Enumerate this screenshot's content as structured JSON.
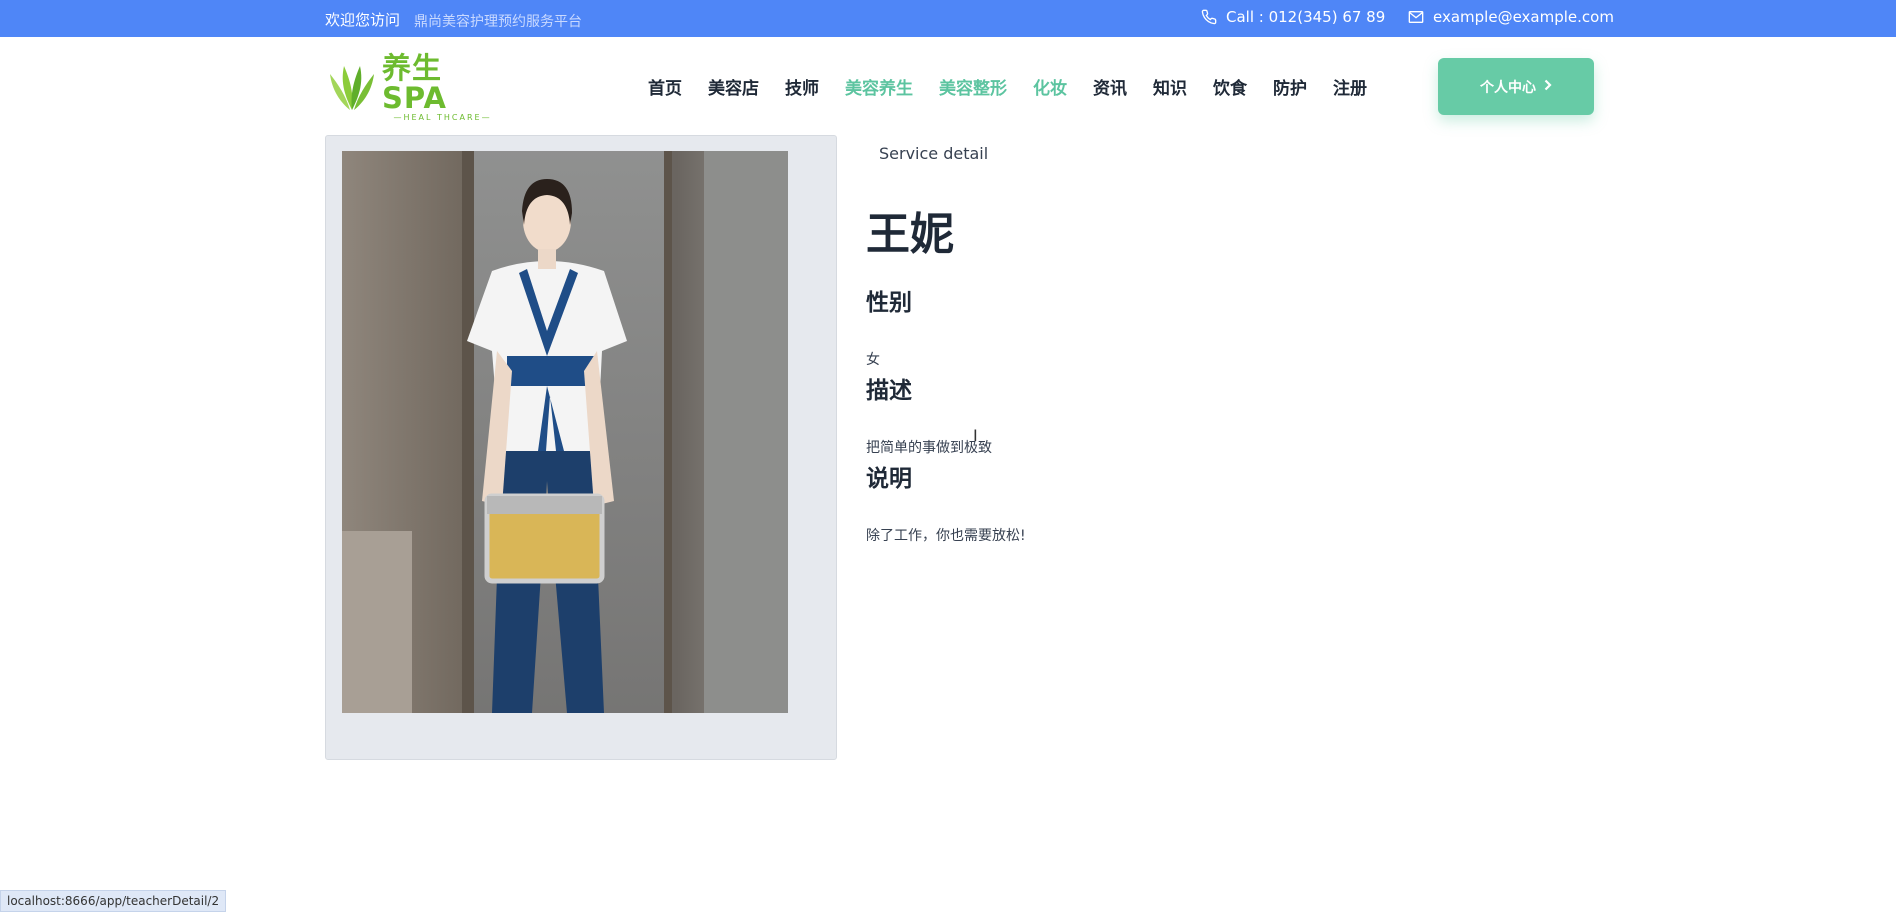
{
  "topbar": {
    "welcome": "欢迎您访问",
    "platform": "鼎尚美容护理预约服务平台",
    "phone": "Call : 012(345) 67 89",
    "email": "example@example.com",
    "phone_icon": "phone-icon",
    "email_icon": "mail-icon"
  },
  "logo": {
    "main": "养生SPA",
    "sub": "HEAL THCARE"
  },
  "nav": {
    "items": [
      {
        "label": "首页"
      },
      {
        "label": "美容店"
      },
      {
        "label": "技师"
      },
      {
        "label": "美容养生"
      },
      {
        "label": "美容整形"
      },
      {
        "label": "化妆"
      },
      {
        "label": "资讯"
      },
      {
        "label": "知识"
      },
      {
        "label": "饮食"
      },
      {
        "label": "防护"
      },
      {
        "label": "注册"
      }
    ]
  },
  "cta": {
    "label": "个人中心"
  },
  "detail": {
    "eyebrow": "Service detail",
    "name": "王妮",
    "gender_heading": "性别",
    "gender_value": "女",
    "desc_heading": "描述",
    "desc_value": "把简单的事做到极致",
    "note_heading": "说明",
    "note_value": "除了工作，你也需要放松!"
  },
  "status_bar": {
    "url": "localhost:8666/app/teacherDetail/2"
  },
  "colors": {
    "topbar": "#4f86f7",
    "accent": "#5cc4a0",
    "cta": "#67cba6",
    "logo": "#6dbb2f"
  }
}
